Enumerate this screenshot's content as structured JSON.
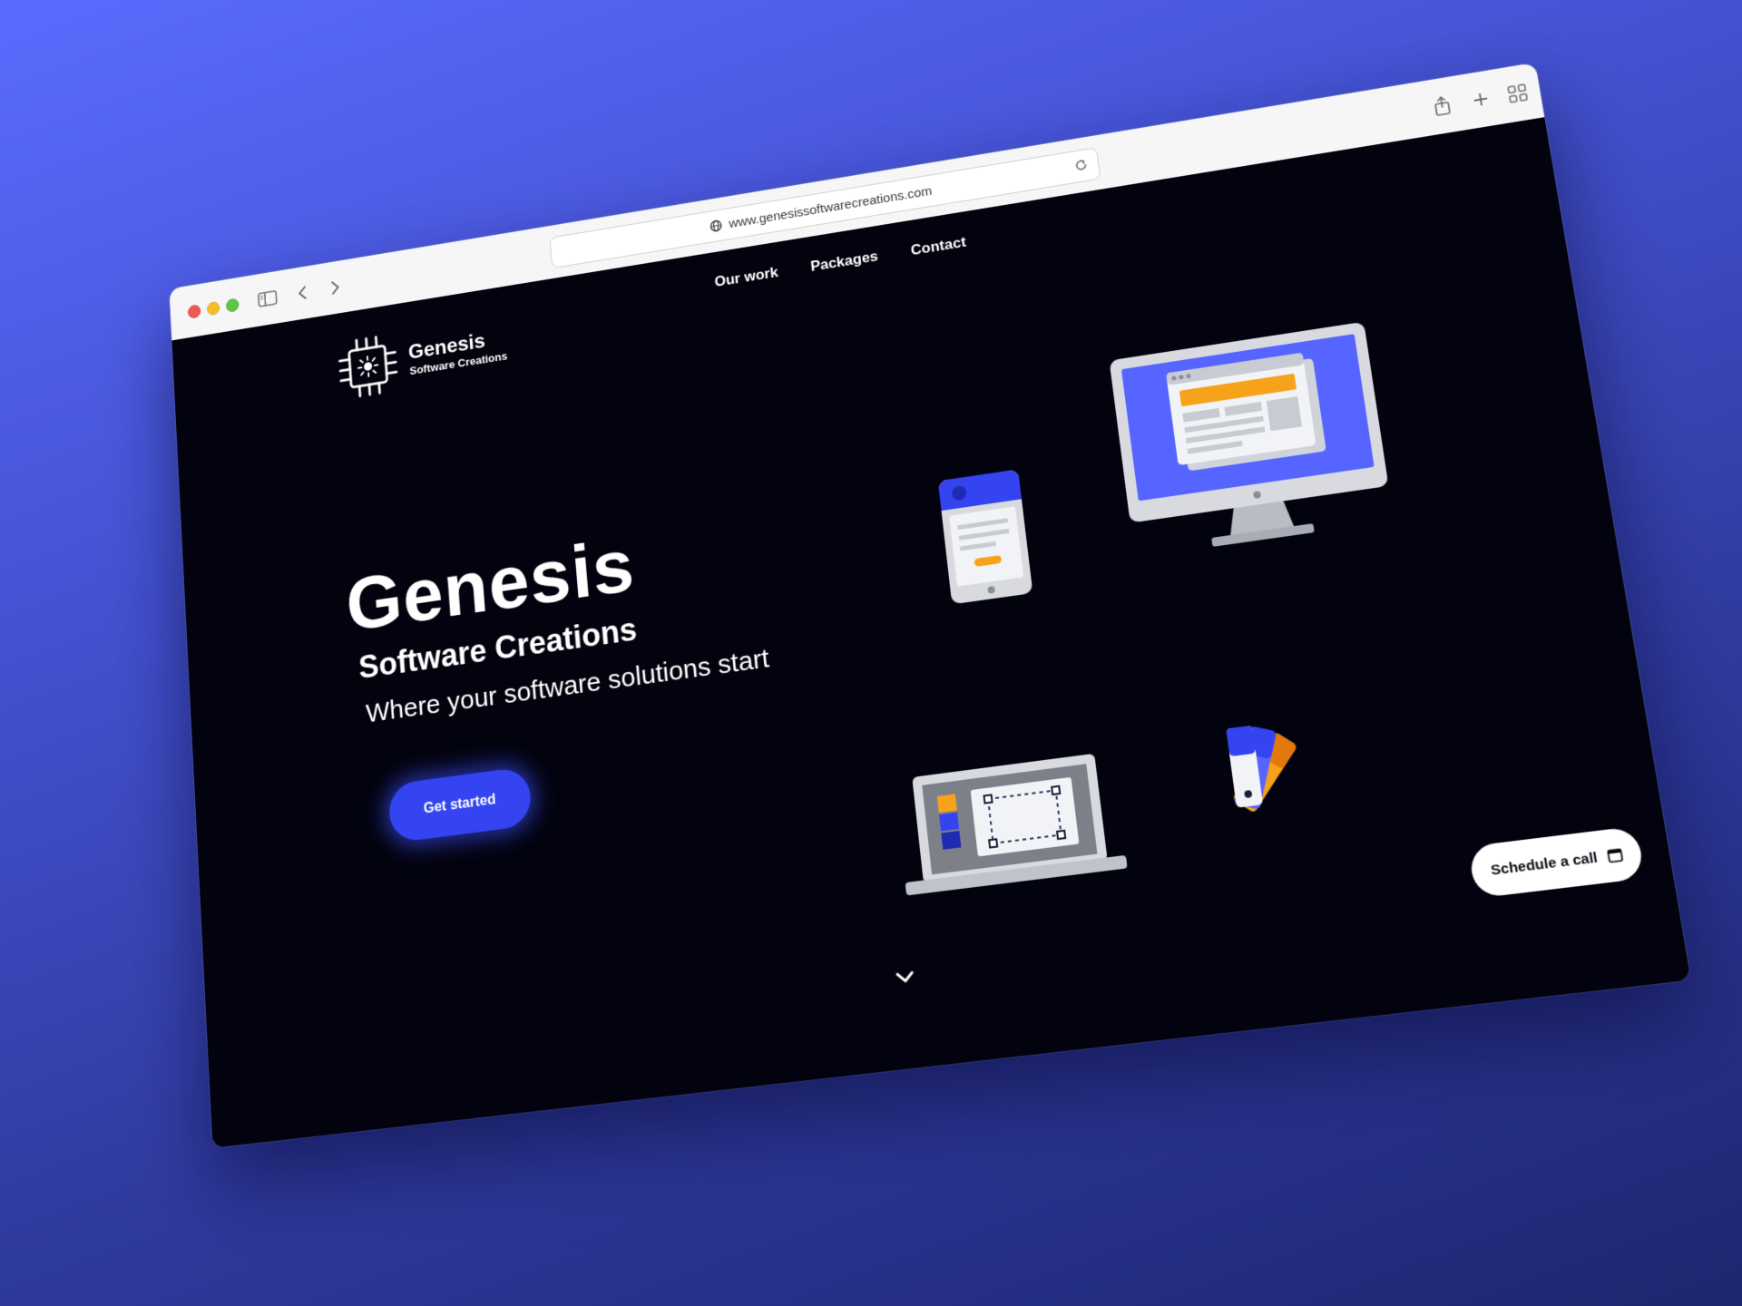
{
  "browser": {
    "url": "www.genesissoftwarecreations.com",
    "icons": [
      "sidebar-icon",
      "back-icon",
      "forward-icon",
      "reload-icon",
      "share-icon",
      "new-tab-icon",
      "tabs-overview-icon"
    ]
  },
  "site": {
    "logo": {
      "name": "Genesis",
      "subtitle": "Software Creations"
    },
    "nav": [
      "Our work",
      "Packages",
      "Contact"
    ],
    "hero": {
      "title": "Genesis",
      "subtitle": "Software Creations",
      "tagline": "Where your software solutions start",
      "cta_label": "Get started"
    },
    "schedule_label": "Schedule a call",
    "colors": {
      "accent": "#3344f0",
      "background": "#03030f",
      "highlight": "#f7a21b"
    }
  }
}
